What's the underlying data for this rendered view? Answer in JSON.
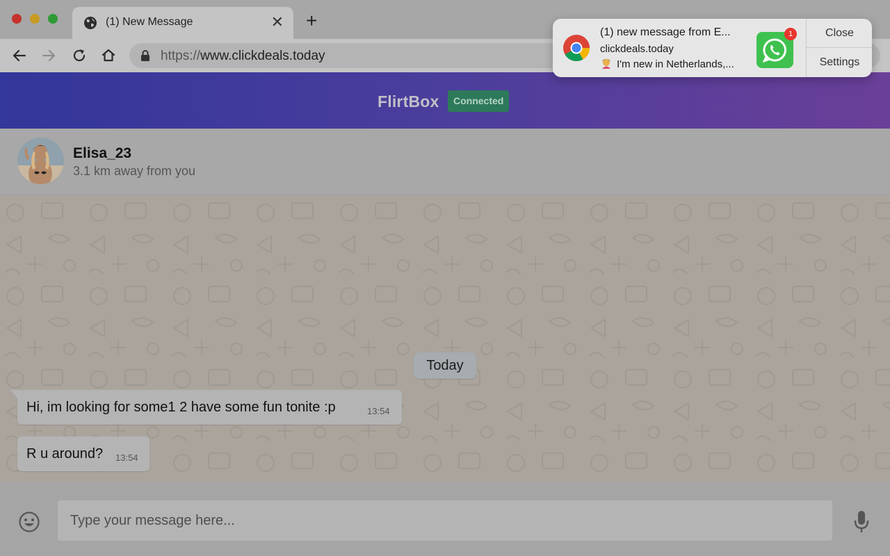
{
  "browser": {
    "tab_title": "(1) New Message",
    "tab_close": "✕",
    "new_tab": "+",
    "url_scheme": "https://",
    "url_host": "www.clickdeals.today"
  },
  "header": {
    "brand": "FlirtBox",
    "status_badge": "Connected"
  },
  "contact": {
    "name": "Elisa_23",
    "distance": "3.1 km away from you"
  },
  "chat": {
    "day_label": "Today",
    "messages": [
      {
        "text": "Hi, im looking for some1 2 have some fun tonite :p",
        "time": "13:54"
      },
      {
        "text": "R u around?",
        "time": "13:54"
      }
    ]
  },
  "composer": {
    "placeholder": "Type your message here..."
  },
  "notification": {
    "title": "(1) new message from E...",
    "site": "clickdeals.today",
    "body": "I'm new in Netherlands,...",
    "badge_count": "1",
    "close_label": "Close",
    "settings_label": "Settings"
  },
  "icons": {
    "tab": "globe-icon",
    "nav": [
      "back-arrow-icon",
      "forward-arrow-icon",
      "reload-icon",
      "home-icon"
    ],
    "url": "lock-icon",
    "composer": [
      "emoji-icon",
      "microphone-icon"
    ],
    "notification": [
      "chrome-logo-icon",
      "whatsapp-icon"
    ]
  },
  "colors": {
    "header_start": "#33369a",
    "header_end": "#6a3f98",
    "badge_bg": "#2d7a5a",
    "whatsapp_green": "#3fc14f",
    "badge_red": "#e8352d"
  }
}
